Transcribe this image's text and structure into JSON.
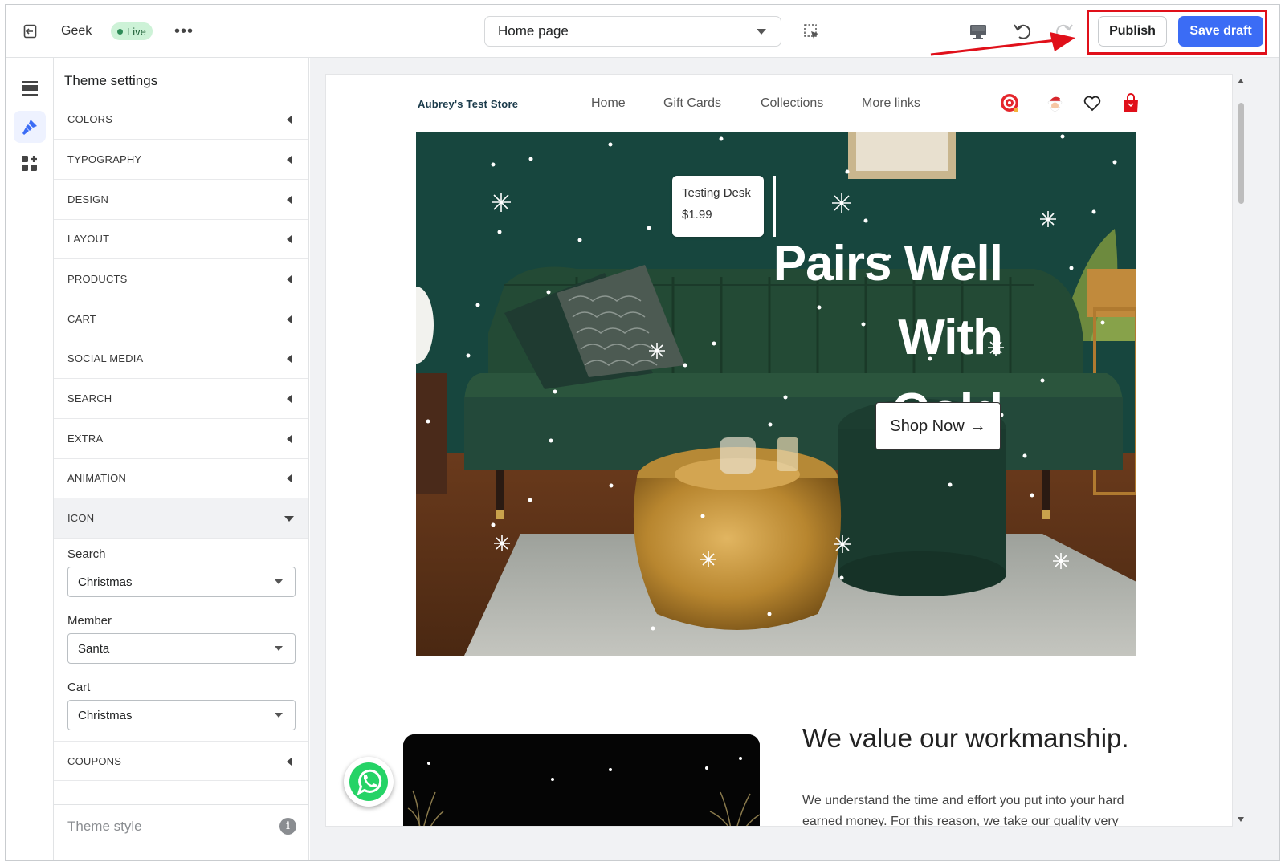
{
  "topbar": {
    "theme_name": "Geek",
    "live_badge": "Live",
    "more_label": "•••",
    "page_select": "Home page",
    "publish_label": "Publish",
    "save_label": "Save draft"
  },
  "panel": {
    "title": "Theme settings",
    "sections": [
      "COLORS",
      "TYPOGRAPHY",
      "DESIGN",
      "LAYOUT",
      "PRODUCTS",
      "CART",
      "SOCIAL MEDIA",
      "SEARCH",
      "EXTRA",
      "ANIMATION",
      "ICON"
    ],
    "icon_fields": {
      "search_label": "Search",
      "search_value": "Christmas",
      "member_label": "Member",
      "member_value": "Santa",
      "cart_label": "Cart",
      "cart_value": "Christmas"
    },
    "after_sections": [
      "COUPONS"
    ],
    "theme_style": "Theme style",
    "info_glyph": "i"
  },
  "store": {
    "name": "Aubrey's Test Store",
    "nav": [
      "Home",
      "Gift Cards",
      "Collections",
      "More links"
    ],
    "hero": {
      "tag_name": "Testing Desk",
      "tag_price": "$1.99",
      "heading_line1": "Pairs Well With",
      "heading_line2": "Gold",
      "button_label": "Shop Now",
      "button_arrow": "→"
    },
    "section2": {
      "title": "We value our workmanship.",
      "text": "We understand the time and effort you put into your hard earned money. For this reason, we take our quality very"
    }
  },
  "colors": {
    "accent_blue": "#3b6cf5",
    "highlight_red": "#e0101a",
    "live_green": "#cdf2d7",
    "hero_wall": "#17463e"
  }
}
